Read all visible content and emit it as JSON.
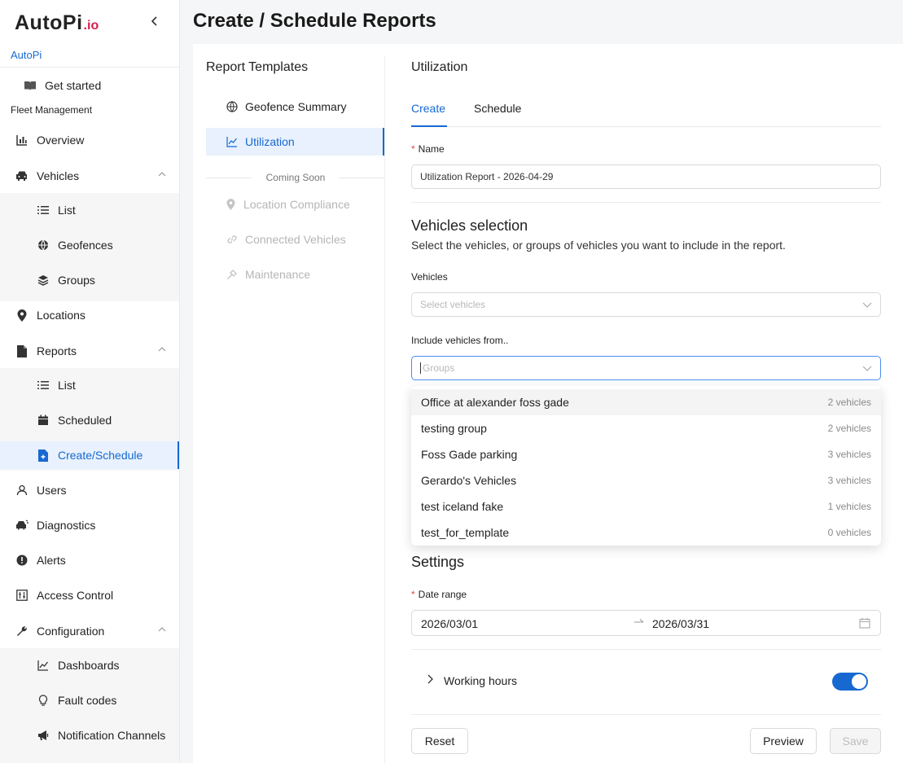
{
  "app": {
    "logo_main": "AutoPi",
    "logo_suffix": ".io",
    "org": "AutoPi"
  },
  "sidebar": {
    "get_started": "Get started",
    "section_fleet": "Fleet Management",
    "overview": "Overview",
    "vehicles": "Vehicles",
    "vehicles_list": "List",
    "vehicles_geofences": "Geofences",
    "vehicles_groups": "Groups",
    "locations": "Locations",
    "reports": "Reports",
    "reports_list": "List",
    "reports_scheduled": "Scheduled",
    "reports_create": "Create/Schedule",
    "users": "Users",
    "diagnostics": "Diagnostics",
    "alerts": "Alerts",
    "access_control": "Access Control",
    "configuration": "Configuration",
    "config_dashboards": "Dashboards",
    "config_fault_codes": "Fault codes",
    "config_notification": "Notification Channels"
  },
  "header": {
    "title": "Create / Schedule Reports"
  },
  "templates": {
    "title": "Report Templates",
    "geofence_summary": "Geofence Summary",
    "utilization": "Utilization",
    "coming_soon": "Coming Soon",
    "location_compliance": "Location Compliance",
    "connected_vehicles": "Connected Vehicles",
    "maintenance": "Maintenance"
  },
  "form": {
    "title": "Utilization",
    "tab_create": "Create",
    "tab_schedule": "Schedule",
    "name_label": "Name",
    "name_value": "Utilization Report - 2026-04-29",
    "vehicles_section": "Vehicles selection",
    "vehicles_desc": "Select the vehicles, or groups of vehicles you want to include in the report.",
    "vehicles_label": "Vehicles",
    "vehicles_placeholder": "Select vehicles",
    "groups_label": "Include vehicles from..",
    "groups_placeholder": "Groups",
    "settings_section": "Settings",
    "date_range_label": "Date range",
    "date_start": "2026/03/01",
    "date_end": "2026/03/31",
    "working_hours": "Working hours",
    "working_hours_enabled": true,
    "reset": "Reset",
    "preview": "Preview",
    "save": "Save"
  },
  "groups_dropdown": [
    {
      "name": "Office at alexander foss gade",
      "count": "2 vehicles"
    },
    {
      "name": "testing group",
      "count": "2 vehicles"
    },
    {
      "name": "Foss Gade parking",
      "count": "3 vehicles"
    },
    {
      "name": "Gerardo's Vehicles",
      "count": "3 vehicles"
    },
    {
      "name": "test iceland fake",
      "count": "1 vehicles"
    },
    {
      "name": "test_for_template",
      "count": "0 vehicles"
    }
  ],
  "colors": {
    "accent": "#1769d1",
    "logo_io": "#d6204e",
    "active_bg": "#e8f1fd"
  }
}
